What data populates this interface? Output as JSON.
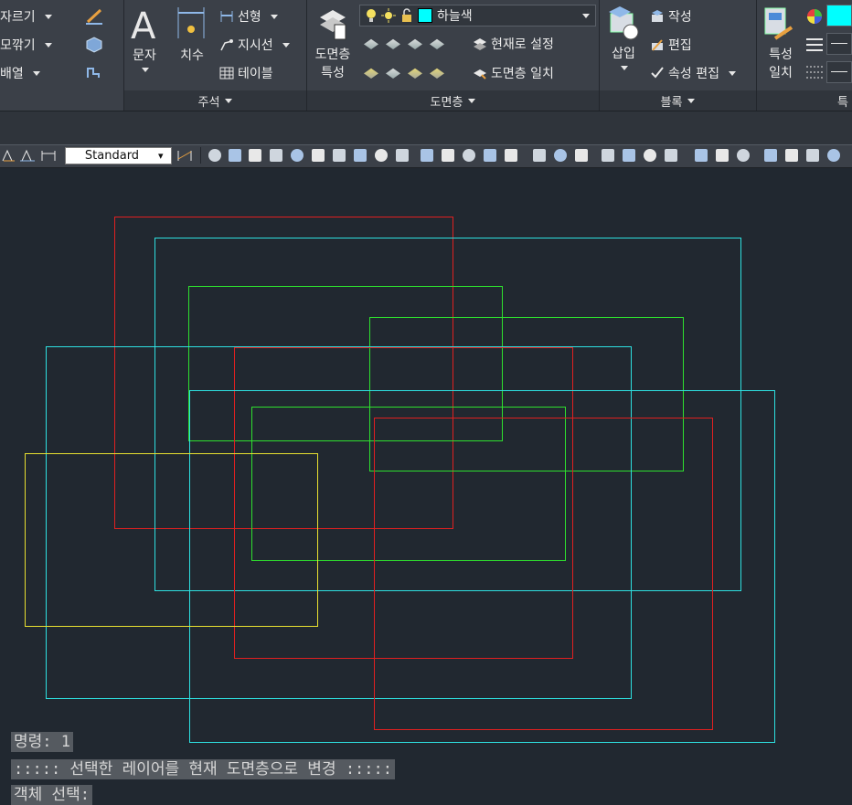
{
  "ribbon": {
    "modify": {
      "items": [
        "자르기",
        "모깎기",
        "배열"
      ]
    },
    "annotation": {
      "title": "주석",
      "text_label": "문자",
      "dim_label": "치수",
      "items": [
        "선형",
        "지시선",
        "테이블"
      ]
    },
    "layers": {
      "title": "도면층",
      "props_label": [
        "도면층",
        "특성"
      ],
      "current_layer": "하늘색",
      "current_layer_color": "#00ffff",
      "set_current": "현재로 설정",
      "match_layer": "도면층 일치"
    },
    "block": {
      "title": "블록",
      "insert_label": "삽입",
      "items": [
        "작성",
        "편집",
        "속성 편집"
      ]
    },
    "properties": {
      "match_label": [
        "특성",
        "일치"
      ],
      "title_fragment": "특"
    }
  },
  "toolbar": {
    "text_style": "Standard"
  },
  "drawing": {
    "rectangles": [
      {
        "color": "#e02020",
        "label": "red-1"
      },
      {
        "color": "#2ee0e0",
        "label": "cyan-1"
      },
      {
        "color": "#2ee02e",
        "label": "green-1"
      },
      {
        "color": "#2ee02e",
        "label": "green-2"
      },
      {
        "color": "#2ee0e0",
        "label": "cyan-2"
      },
      {
        "color": "#e02020",
        "label": "red-2"
      },
      {
        "color": "#2ee0e0",
        "label": "cyan-3"
      },
      {
        "color": "#2ee02e",
        "label": "green-3"
      },
      {
        "color": "#e02020",
        "label": "red-3"
      },
      {
        "color": "#e8e030",
        "label": "yellow-1"
      }
    ]
  },
  "command_line": {
    "lines": [
      "명령: 1",
      "::::: 선택한 레이어를 현재 도면층으로 변경 :::::",
      "객체 선택:"
    ]
  },
  "icons": [
    "pencil-icon",
    "cube-icon",
    "offset-icon",
    "text-icon",
    "dimension-icon",
    "linear-icon",
    "leader-icon",
    "table-icon",
    "layer-properties-icon",
    "bulb-icon",
    "sun-icon",
    "lock-icon",
    "insert-block-icon",
    "create-block-icon",
    "edit-block-icon",
    "edit-attribute-icon",
    "match-properties-icon",
    "color-wheel-icon",
    "lineweight-icon",
    "linetype-icon"
  ]
}
